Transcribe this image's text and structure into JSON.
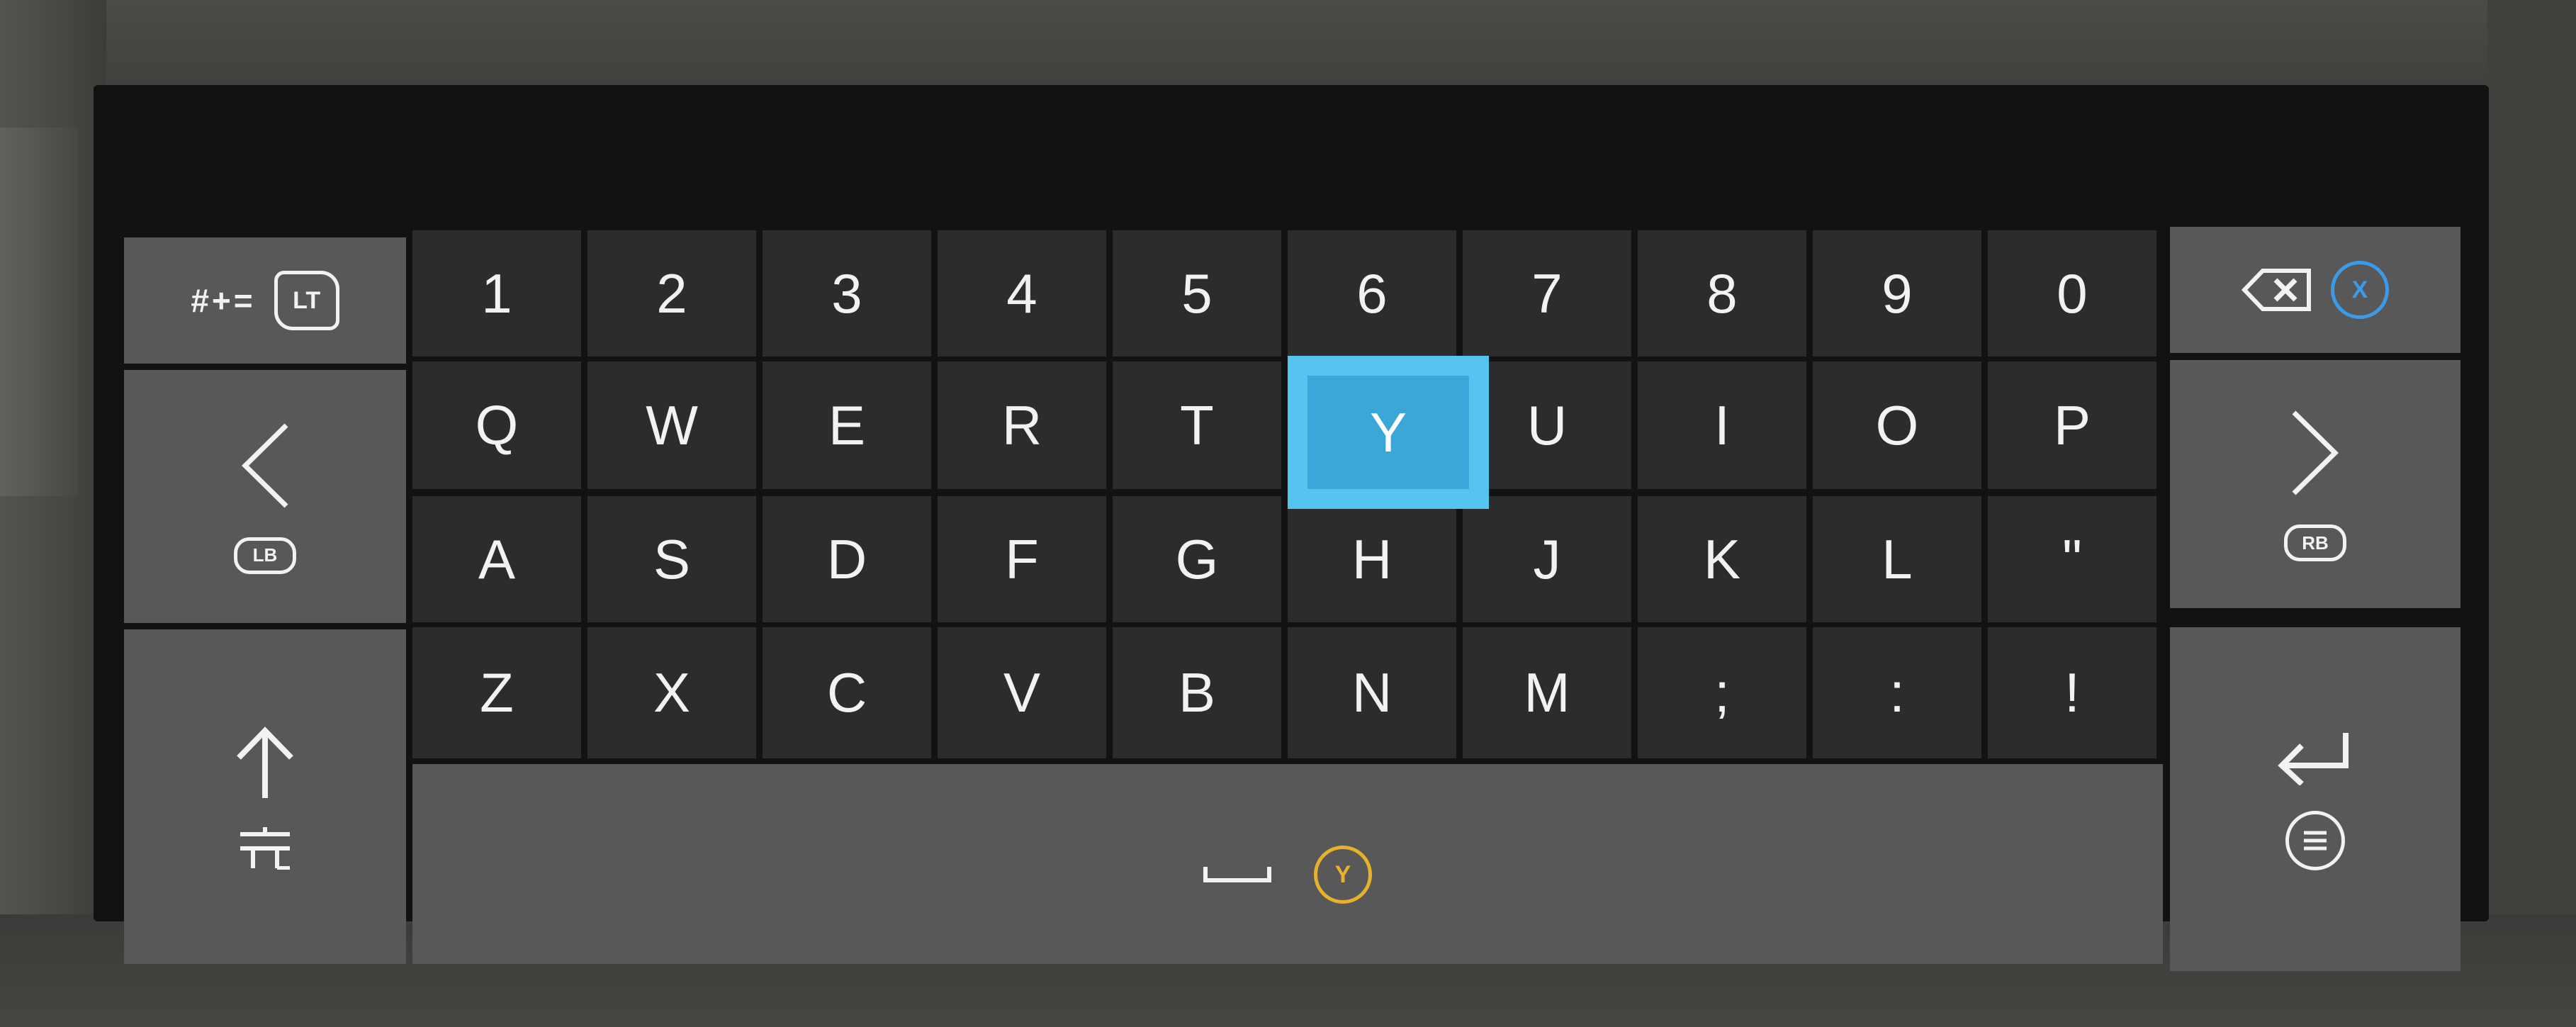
{
  "keyboard": {
    "row1": [
      "1",
      "2",
      "3",
      "4",
      "5",
      "6",
      "7",
      "8",
      "9",
      "0"
    ],
    "row2": [
      "Q",
      "W",
      "E",
      "R",
      "T",
      "Y",
      "U",
      "I",
      "O",
      "P"
    ],
    "row3": [
      "A",
      "S",
      "D",
      "F",
      "G",
      "H",
      "J",
      "K",
      "L",
      "\""
    ],
    "row4": [
      "Z",
      "X",
      "C",
      "V",
      "B",
      "N",
      "M",
      ";",
      ":",
      "!"
    ],
    "selected_key": "Y"
  },
  "side": {
    "symbols_label": "#+=",
    "symbols_button": "LT",
    "left_button": "LB",
    "right_button": "RB",
    "backspace_button": "X",
    "space_button": "Y"
  },
  "colors": {
    "key_bg": "#2c2c2c",
    "side_bg": "#585858",
    "selected": "#3aa7d8",
    "x_button": "#3b9be8",
    "y_button": "#e8b12c"
  },
  "icons": {
    "back": "chevron-left-icon",
    "forward": "chevron-right-icon",
    "shift": "arrow-up-icon",
    "caps": "caps-lock-icon",
    "backspace": "backspace-icon",
    "enter": "enter-icon",
    "menu": "menu-icon",
    "space": "space-icon"
  }
}
